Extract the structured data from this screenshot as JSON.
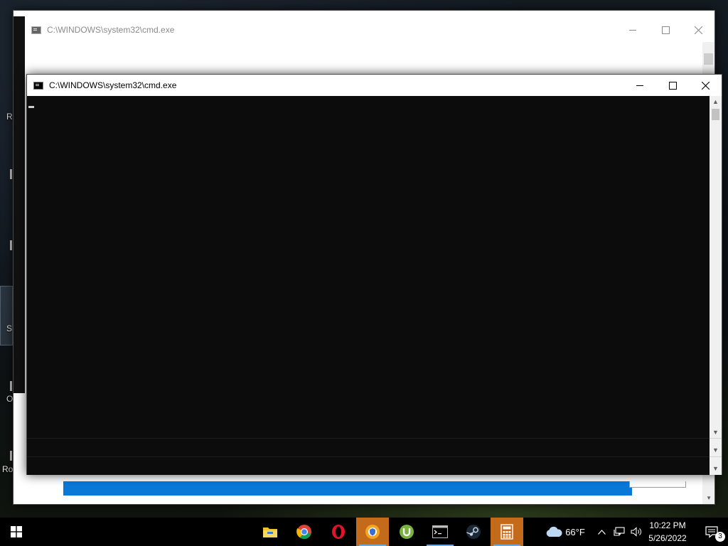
{
  "back_window": {
    "title": "C:\\WINDOWS\\system32\\cmd.exe"
  },
  "cmd_window": {
    "title": "C:\\WINDOWS\\system32\\cmd.exe",
    "controls": {
      "minimize": "minimize",
      "maximize": "maximize",
      "close": "close"
    }
  },
  "desktop": {
    "labels": [
      "R",
      "S",
      "O",
      "Ro"
    ]
  },
  "taskbar": {
    "start_icon": "windows-start-icon",
    "apps": [
      {
        "name": "file-explorer-icon",
        "color": "#f2c12e"
      },
      {
        "name": "chrome-icon",
        "color": "#4285f4"
      },
      {
        "name": "opera-icon",
        "color": "#e0132b"
      },
      {
        "name": "secure-browser-icon",
        "color": "#f4a524"
      },
      {
        "name": "utorrent-icon",
        "color": "#78b340"
      },
      {
        "name": "command-prompt-icon",
        "color": "#ffffff"
      },
      {
        "name": "steam-icon",
        "color": "#c8d4e0"
      },
      {
        "name": "calculator-icon",
        "color": "#ffffff"
      }
    ],
    "weather": {
      "temperature": "66°F",
      "icon": "cloud-icon"
    },
    "clock": {
      "time": "10:22 PM",
      "date": "5/26/2022"
    },
    "notifications": {
      "count": "3"
    }
  }
}
